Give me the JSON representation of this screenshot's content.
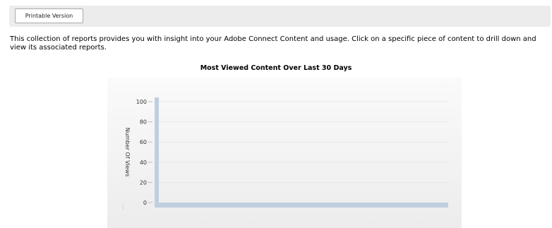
{
  "toolbar": {
    "printable_label": "Printable Version"
  },
  "intro_text": "This collection of reports provides you with insight into your Adobe Connect Content and usage. Click on a specific piece of content to drill down and view its associated reports.",
  "chart_data": {
    "type": "bar",
    "title": "Most Viewed Content Over Last 30 Days",
    "xlabel": "",
    "ylabel": "Number Of Views",
    "ylim": [
      0,
      100
    ],
    "yticks": [
      0,
      20,
      40,
      60,
      80,
      100
    ],
    "categories": [],
    "values": [],
    "grid": true,
    "axis_color": "#bfcfdf"
  }
}
